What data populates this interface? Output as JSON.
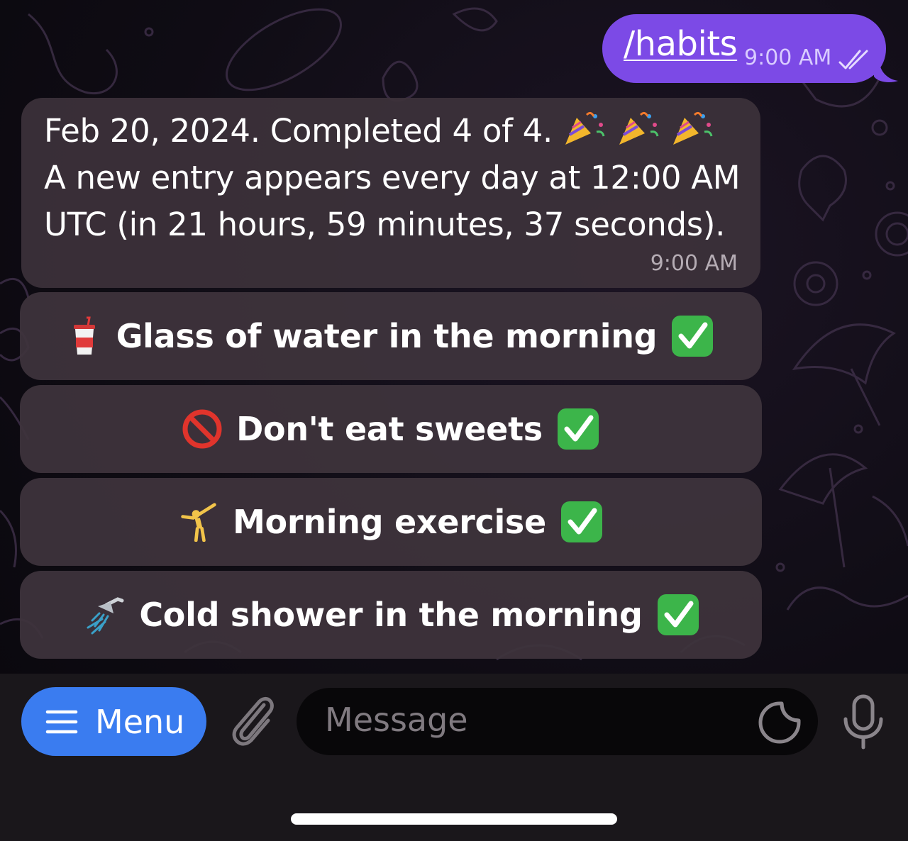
{
  "outgoing": {
    "command": "/habits",
    "time": "9:00 AM",
    "status_icon": "double-check-icon"
  },
  "incoming": {
    "line1": "Feb 20, 2024. Completed 4 of 4.",
    "line1_emoji": "party-popper-icon x3",
    "line2": "A new entry appears every day at 12:00 AM",
    "line3": "UTC (in 21 hours, 59 minutes, 37 seconds).",
    "time": "9:00 AM"
  },
  "buttons": [
    {
      "icon": "cup-with-straw-icon",
      "label": "Glass of water in the morning",
      "done_icon": "check-mark-button-icon"
    },
    {
      "icon": "prohibited-icon",
      "label": "Don't eat sweets",
      "done_icon": "check-mark-button-icon"
    },
    {
      "icon": "cartwheel-icon",
      "label": "Morning exercise",
      "done_icon": "check-mark-button-icon"
    },
    {
      "icon": "shower-icon",
      "label": "Cold shower in the morning",
      "done_icon": "check-mark-button-icon"
    }
  ],
  "input_bar": {
    "menu_label": "Menu",
    "message_placeholder": "Message"
  },
  "colors": {
    "outgoing_bubble": "#7c4ae6",
    "menu_button": "#3a7cf0",
    "check_green": "#3cb54a"
  }
}
